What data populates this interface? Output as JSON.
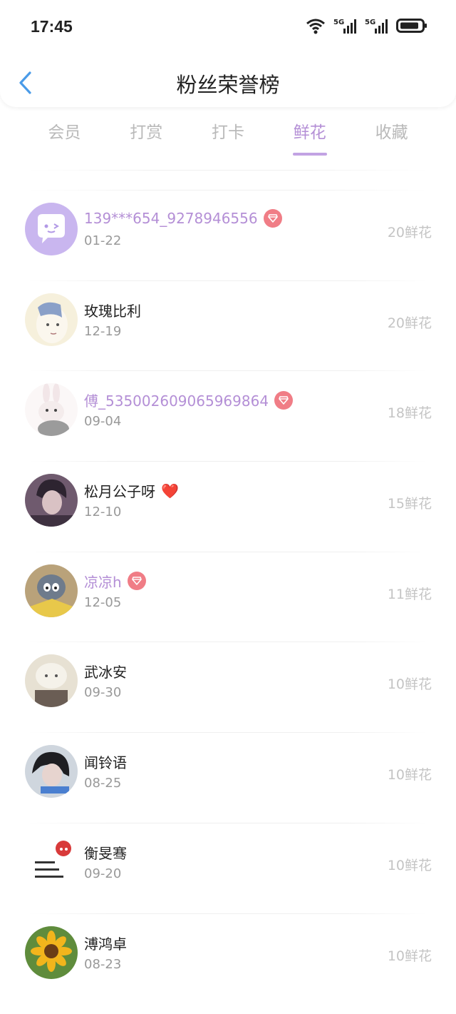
{
  "status_bar": {
    "time": "17:45"
  },
  "header": {
    "title": "粉丝荣誉榜"
  },
  "tabs": [
    {
      "label": "会员",
      "active": false
    },
    {
      "label": "打赏",
      "active": false
    },
    {
      "label": "打卡",
      "active": false
    },
    {
      "label": "鲜花",
      "active": true
    },
    {
      "label": "收藏",
      "active": false
    }
  ],
  "fans": [
    {
      "name": "139***654_9278946556",
      "date": "01-22",
      "count": "20鲜花",
      "vip": true
    },
    {
      "name": "玫瑰比利",
      "date": "12-19",
      "count": "20鲜花",
      "vip": false
    },
    {
      "name": "傅_535002609065969864",
      "date": "09-04",
      "count": "18鲜花",
      "vip": true
    },
    {
      "name": "松月公子呀",
      "date": "12-10",
      "count": "15鲜花",
      "vip": false,
      "heart": "❤️"
    },
    {
      "name": "凉凉h",
      "date": "12-05",
      "count": "11鲜花",
      "vip": true
    },
    {
      "name": "武冰安",
      "date": "09-30",
      "count": "10鲜花",
      "vip": false
    },
    {
      "name": "闻铃语",
      "date": "08-25",
      "count": "10鲜花",
      "vip": false
    },
    {
      "name": "衡旻骞",
      "date": "09-20",
      "count": "10鲜花",
      "vip": false
    },
    {
      "name": "溥鸿卓",
      "date": "08-23",
      "count": "10鲜花",
      "vip": false
    }
  ],
  "colors": {
    "accent": "#b48fd6",
    "gem": "#f07d86",
    "muted": "#c4c4c4"
  }
}
